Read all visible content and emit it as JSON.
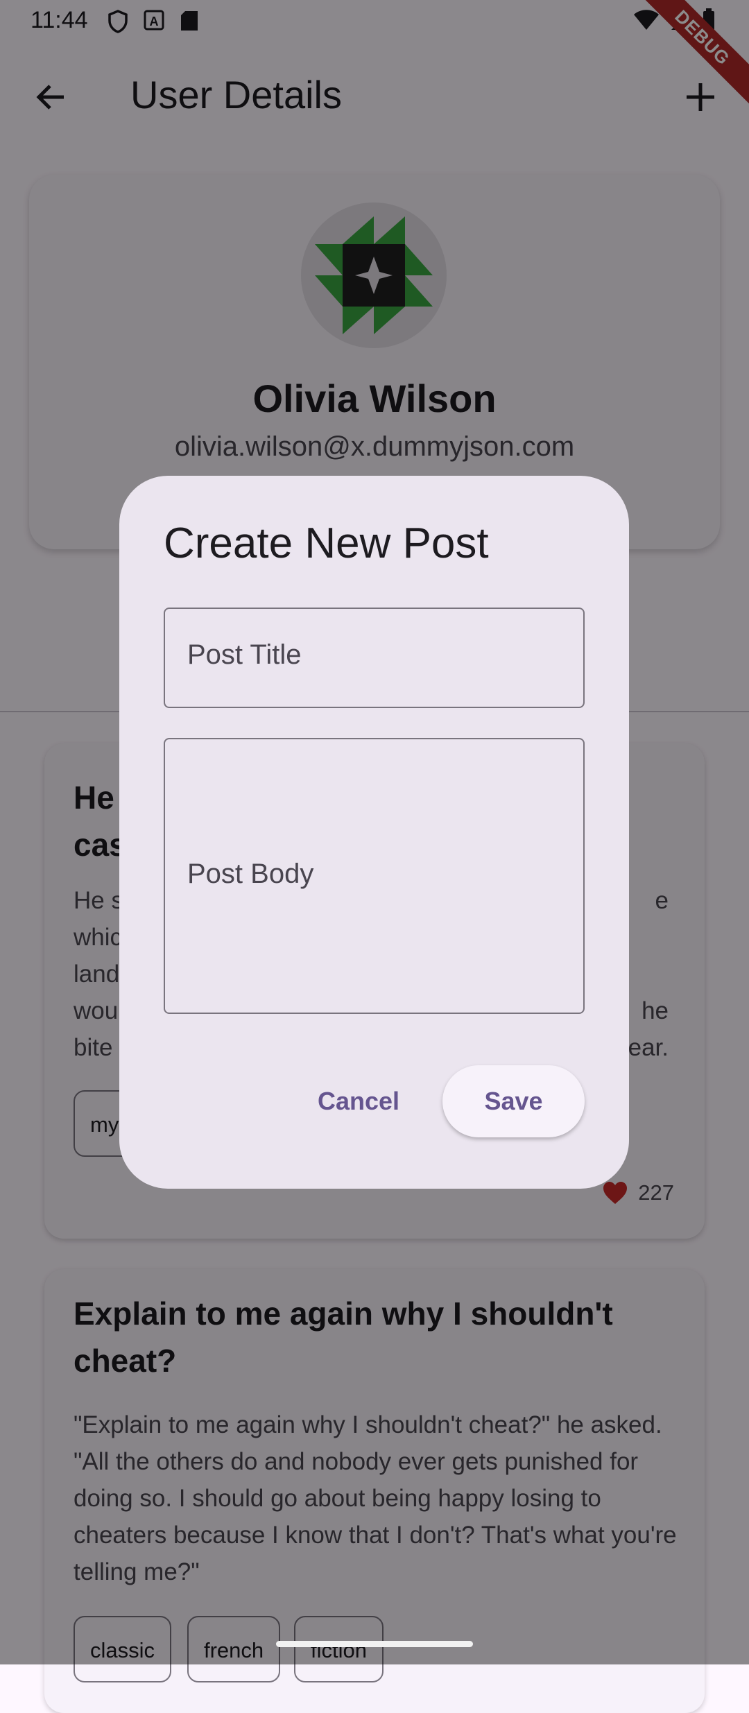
{
  "status_bar": {
    "time": "11:44",
    "debug": "DEBUG"
  },
  "appbar": {
    "title": "User Details"
  },
  "profile": {
    "name": "Olivia Wilson",
    "email": "olivia.wilson@x.dummyjson.com"
  },
  "posts": [
    {
      "title_line1": "He",
      "title_line2": "cas",
      "body_lines": [
        "He s",
        "whic",
        "land",
        "wou",
        "bite"
      ],
      "body_right": [
        "e",
        "",
        "",
        "he",
        "ear."
      ],
      "tags": [
        "my"
      ],
      "likes": "227"
    },
    {
      "title": "Explain to me again why I shouldn't cheat?",
      "body": "\"Explain to me again why I shouldn't cheat?\" he asked. \"All the others do and nobody ever gets punished for doing so. I should go about being happy losing to cheaters because I know that I don't? That's what you're telling me?\"",
      "tags": [
        "classic",
        "french",
        "fiction"
      ]
    }
  ],
  "dialog": {
    "title": "Create New Post",
    "title_field": {
      "label": "Post Title",
      "value": ""
    },
    "body_field": {
      "label": "Post Body",
      "value": ""
    },
    "cancel_label": "Cancel",
    "save_label": "Save"
  },
  "colors": {
    "accent": "#65558f",
    "like": "#c62828",
    "debug": "#b02828"
  }
}
